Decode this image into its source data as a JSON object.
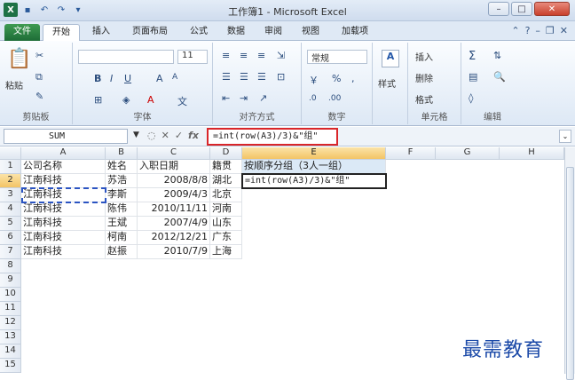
{
  "window": {
    "title": "工作簿1 - Microsoft Excel"
  },
  "tabs": [
    "文件",
    "开始",
    "插入",
    "页面布局",
    "公式",
    "数据",
    "审阅",
    "视图",
    "加载项"
  ],
  "ribbon": {
    "groups": [
      "剪贴板",
      "字体",
      "对齐方式",
      "数字",
      "单元格",
      "编辑"
    ],
    "paste": "粘贴",
    "font_size": "11",
    "number_format": "常规",
    "styles": "样式",
    "insert": "插入",
    "delete": "删除",
    "format": "格式"
  },
  "formula_bar": {
    "name_box": "SUM",
    "formula": "=int(row(A3)/3)&\"组\""
  },
  "columns": [
    "A",
    "B",
    "C",
    "D",
    "E",
    "F",
    "G",
    "H"
  ],
  "rows": [
    "1",
    "2",
    "3",
    "4",
    "5",
    "6",
    "7",
    "8",
    "9",
    "10",
    "11",
    "12",
    "13",
    "14",
    "15"
  ],
  "cells": {
    "header": [
      "公司名称",
      "姓名",
      "入职日期",
      "籍贯",
      "按顺序分组（3人一组）"
    ],
    "data": [
      [
        "江南科技",
        "苏浩",
        "2008/8/8",
        "湖北"
      ],
      [
        "江南科技",
        "李斯",
        "2009/4/3",
        "北京"
      ],
      [
        "江南科技",
        "陈伟",
        "2010/11/11",
        "河南"
      ],
      [
        "江南科技",
        "王斌",
        "2007/4/9",
        "山东"
      ],
      [
        "江南科技",
        "柯南",
        "2012/12/21",
        "广东"
      ],
      [
        "江南科技",
        "赵振",
        "2010/7/9",
        "上海"
      ]
    ],
    "editing": "=int(row(A3)/3)&\"组\""
  },
  "watermark": "最需教育"
}
